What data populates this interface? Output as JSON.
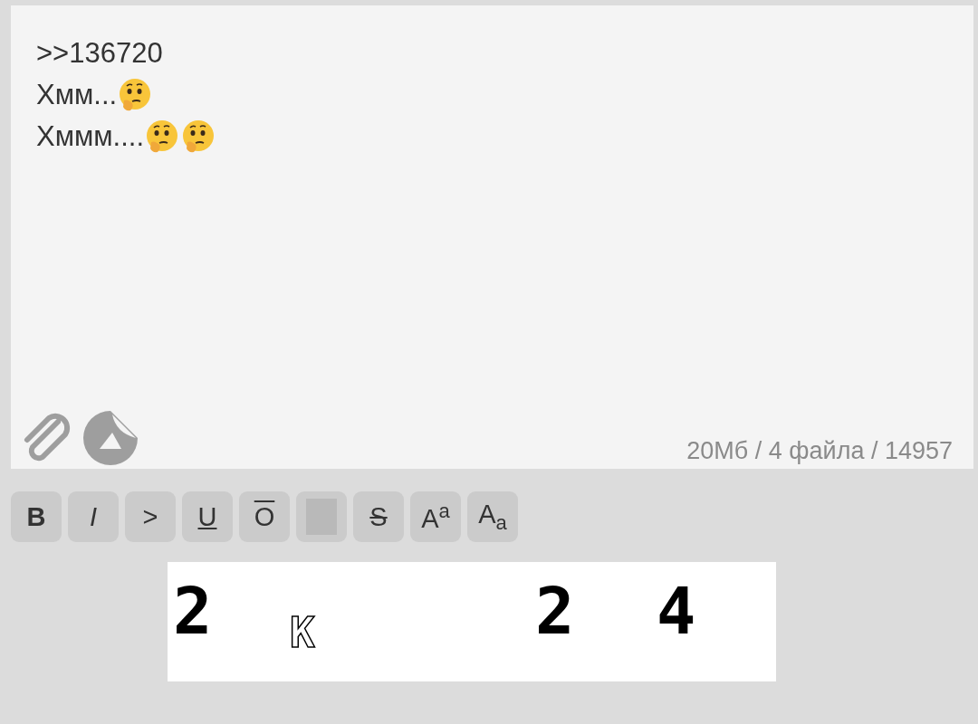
{
  "message": {
    "lines": [
      {
        "text": ">>136720"
      },
      {
        "text": "Хмм...",
        "emoji": [
          {
            "kind": "thinking"
          }
        ]
      },
      {
        "text": "Хммм....",
        "emoji": [
          {
            "kind": "thinking"
          },
          {
            "kind": "thinking"
          }
        ]
      }
    ]
  },
  "attachments": {
    "counter": "20Мб / 4 файла / 14957"
  },
  "toolbar": [
    {
      "kind": "bold",
      "label": "B"
    },
    {
      "kind": "italic",
      "label": "I"
    },
    {
      "kind": "plain",
      "label": ">"
    },
    {
      "kind": "underline",
      "label": "U"
    },
    {
      "kind": "overline",
      "label": "O"
    },
    {
      "kind": "swatch"
    },
    {
      "kind": "strike",
      "label": "S"
    },
    {
      "kind": "rich",
      "label": "A$^{a}$"
    },
    {
      "kind": "rich",
      "label": "A$_{a}$"
    }
  ],
  "captcha": {
    "chars": [
      {
        "char": "2",
        "kind": "solid"
      },
      {
        "char": "K",
        "kind": "outline"
      },
      {
        "char": "2",
        "kind": "solid"
      },
      {
        "char": "4",
        "kind": "solid"
      }
    ]
  }
}
